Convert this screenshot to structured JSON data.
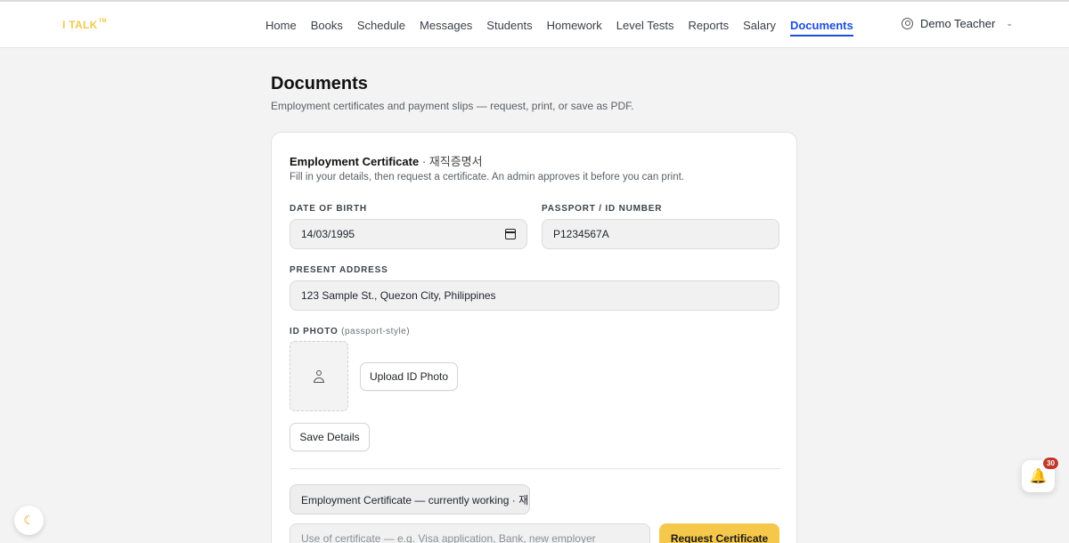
{
  "brand": {
    "logo_text": "I TALK",
    "logo_mark": "TM",
    "accent": "#f2c94c"
  },
  "nav": {
    "items": [
      {
        "label": "Home"
      },
      {
        "label": "Books"
      },
      {
        "label": "Schedule"
      },
      {
        "label": "Messages"
      },
      {
        "label": "Students"
      },
      {
        "label": "Homework"
      },
      {
        "label": "Level Tests"
      },
      {
        "label": "Reports"
      },
      {
        "label": "Salary"
      },
      {
        "label": "Documents",
        "active": true
      }
    ],
    "active_color": "#1d4ed8"
  },
  "user": {
    "name": "Demo Teacher"
  },
  "page": {
    "title": "Documents",
    "subtitle": "Employment certificates and payment slips — request, print, or save as PDF."
  },
  "certificate": {
    "title": "Employment Certificate",
    "title_ko": "· 재직증명서",
    "description": "Fill in your details, then request a certificate. An admin approves it before you can print.",
    "dob_label": "DATE OF BIRTH",
    "dob_value": "14/03/1995",
    "passport_label": "PASSPORT / ID NUMBER",
    "passport_value": "P1234567A",
    "address_label": "PRESENT ADDRESS",
    "address_value": "123 Sample St., Quezon City, Philippines",
    "photo_label": "ID PHOTO",
    "photo_hint": "(passport-style)",
    "upload_label": "Upload ID Photo",
    "save_label": "Save Details",
    "type_selected": "Employment Certificate — currently working · 재직",
    "purpose_placeholder": "Use of certificate — e.g. Visa application, Bank, new employer",
    "request_label": "Request Certificate",
    "request_color": "#f5c84c"
  },
  "notifications": {
    "count": "30"
  }
}
